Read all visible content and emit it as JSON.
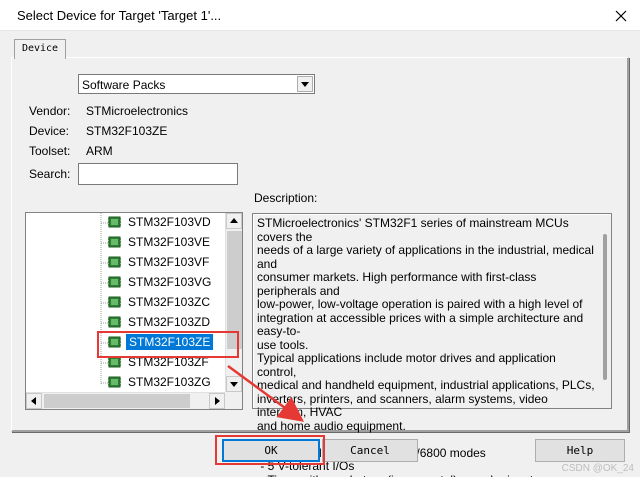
{
  "window": {
    "title": "Select Device for Target 'Target 1'...",
    "close_icon": "close-icon"
  },
  "tabs": [
    {
      "label": "Device"
    }
  ],
  "source_combo": {
    "value": "Software Packs"
  },
  "fields": {
    "vendor_label": "Vendor:",
    "vendor_value": "STMicroelectronics",
    "device_label": "Device:",
    "device_value": "STM32F103ZE",
    "toolset_label": "Toolset:",
    "toolset_value": "ARM",
    "search_label": "Search:",
    "search_value": ""
  },
  "device_list": {
    "items": [
      {
        "name": "STM32F103VD",
        "selected": false
      },
      {
        "name": "STM32F103VE",
        "selected": false
      },
      {
        "name": "STM32F103VF",
        "selected": false
      },
      {
        "name": "STM32F103VG",
        "selected": false
      },
      {
        "name": "STM32F103ZC",
        "selected": false
      },
      {
        "name": "STM32F103ZD",
        "selected": false
      },
      {
        "name": "STM32F103ZE",
        "selected": true
      },
      {
        "name": "STM32F103ZF",
        "selected": false
      },
      {
        "name": "STM32F103ZG",
        "selected": false
      }
    ],
    "item_icon": "chip-icon"
  },
  "description": {
    "label": "Description:",
    "text": "STMicroelectronics' STM32F1 series of mainstream MCUs covers the\nneeds of a large variety of applications in the industrial, medical and\nconsumer markets. High performance with first-class peripherals and\nlow-power, low-voltage operation is paired with a high level of\nintegration at accessible prices with a simple architecture and easy-to-\nuse tools.\nTypical applications include motor drives and application control,\nmedical and handheld equipment, industrial applications, PLCs,\ninverters, printers, and scanners, alarm systems, video intercom, HVAC\nand home audio equipment.\n\n - LCD parallel interface, 8080/6800 modes\n - 5 V-tolerant I/Os\n - Timer with quadrature (incremental) encoder input"
  },
  "buttons": {
    "ok": "OK",
    "cancel": "Cancel",
    "help": "Help"
  },
  "annotation_color": "#e53935",
  "selection_color": "#0078d7",
  "watermark": "CSDN @OK_24"
}
